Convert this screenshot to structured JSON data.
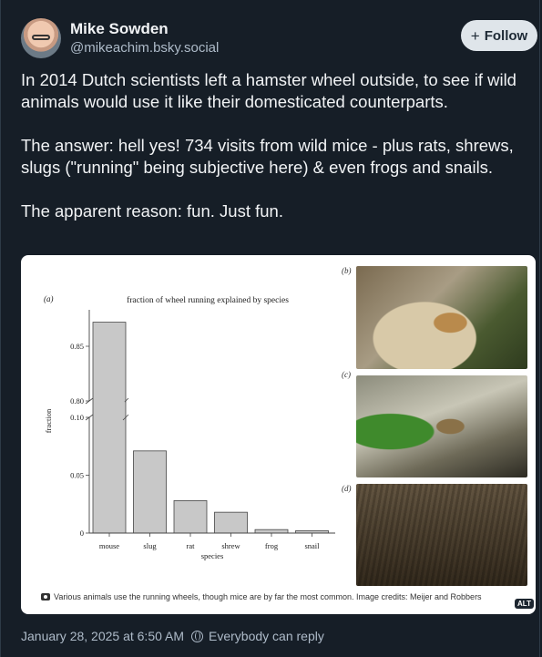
{
  "author": {
    "name": "Mike Sowden",
    "handle": "@mikeachim.bsky.social"
  },
  "follow_label": "Follow",
  "post_text": [
    "In 2014 Dutch scientists left a hamster wheel outside, to see if wild animals would use it like their domesticated counterparts.",
    "The answer: hell yes! 734 visits from wild mice - plus rats, shrews, slugs (\"running\" being subjective here) & even frogs and snails.",
    "The apparent reason: fun. Just fun."
  ],
  "figure": {
    "panel_labels": {
      "a": "(a)",
      "b": "(b)",
      "c": "(c)",
      "d": "(d)"
    },
    "caption": "Various animals use the running wheels, though mice are by far the most common. Image credits: Meijer and Robbers",
    "alt_badge": "ALT"
  },
  "chart_data": {
    "type": "bar",
    "title": "fraction of wheel running explained by species",
    "xlabel": "species",
    "ylabel": "fraction",
    "categories": [
      "mouse",
      "slug",
      "rat",
      "shrew",
      "frog",
      "snail"
    ],
    "values": [
      0.872,
      0.071,
      0.028,
      0.018,
      0.003,
      0.002
    ],
    "y_ticks_lower": [
      "0",
      "0.05",
      "0.10"
    ],
    "y_ticks_upper": [
      "0.80",
      "0.85"
    ],
    "axis_break": true,
    "grid": false
  },
  "timestamp": "January 28, 2025 at 6:50 AM",
  "reply_setting": "Everybody can reply"
}
